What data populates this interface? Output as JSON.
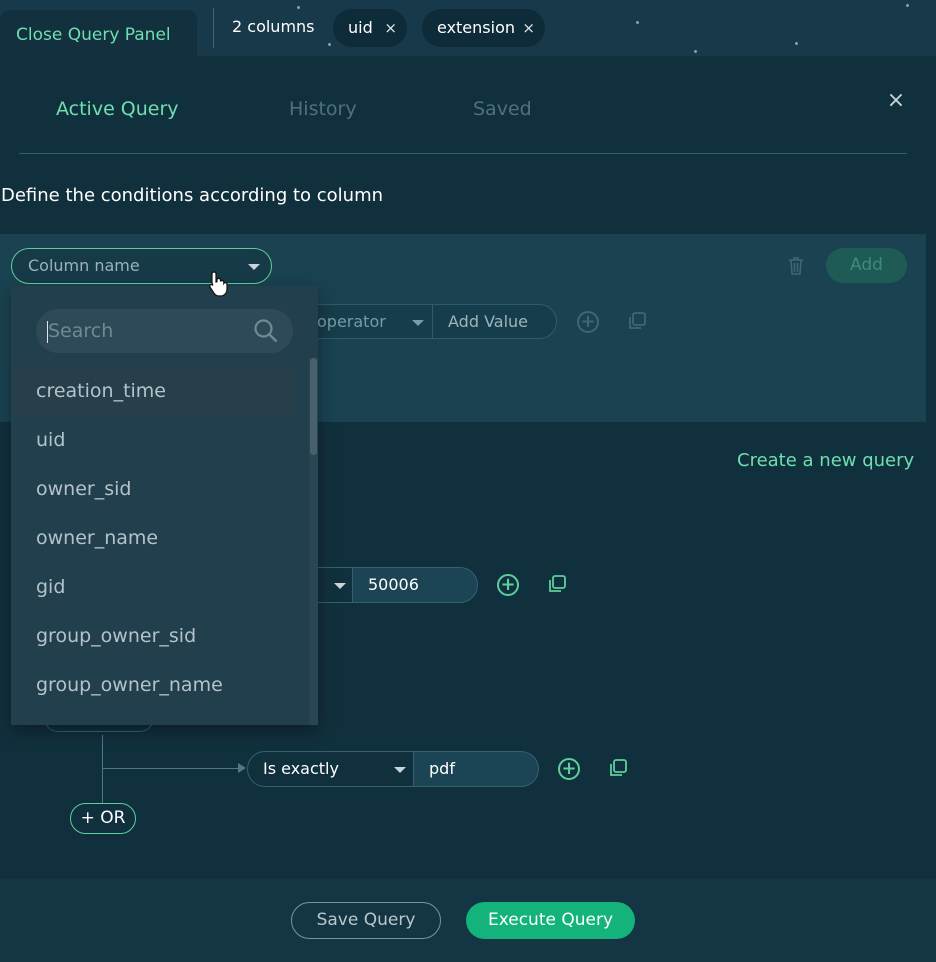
{
  "topbar": {
    "close_panel_label": "Close Query Panel",
    "column_count": "2 columns",
    "chips": [
      {
        "label": "uid",
        "remove": "×"
      },
      {
        "label": "extension",
        "remove": "×"
      }
    ]
  },
  "tabs": [
    {
      "label": "Active Query",
      "active": true
    },
    {
      "label": "History",
      "active": false
    },
    {
      "label": "Saved",
      "active": false
    }
  ],
  "panel_close": "×",
  "instructions": "Define the conditions according to column",
  "group": {
    "column_placeholder": "Column name",
    "operator_placeholder": "operator",
    "value_placeholder": "Add Value",
    "add_label": "Add"
  },
  "create_new_query": "Create a new query",
  "conditions": [
    {
      "operator": "",
      "value": "50006"
    },
    {
      "operator": "Is exactly",
      "value": "pdf"
    }
  ],
  "or_button": "+ OR",
  "dropdown": {
    "search_placeholder": "Search",
    "options": [
      "creation_time",
      "uid",
      "owner_sid",
      "owner_name",
      "gid",
      "group_owner_sid",
      "group_owner_name"
    ],
    "highlighted": "creation_time"
  },
  "footer": {
    "save_label": "Save Query",
    "execute_label": "Execute Query"
  },
  "colors": {
    "accent": "#6fdfb0",
    "execute": "#13b37b",
    "panel": "#11303d"
  }
}
